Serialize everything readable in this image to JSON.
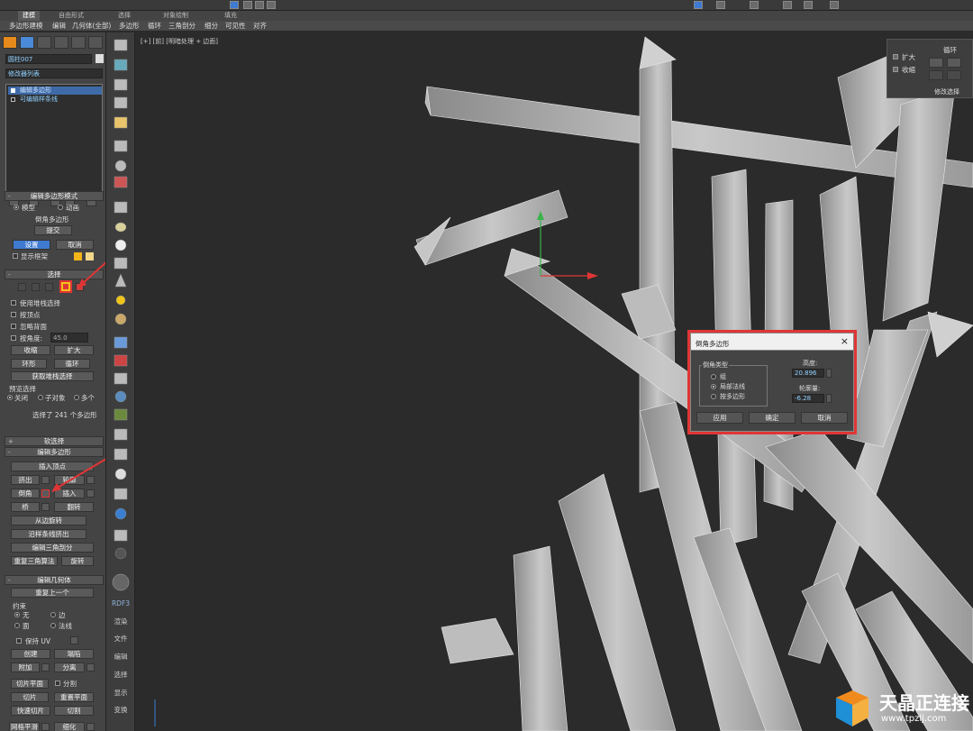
{
  "ribbon": {
    "tabs": [
      "建模",
      "自由形式",
      "选择",
      "对象绘制",
      "填充"
    ],
    "sub_items": [
      "多边形建模",
      "编辑",
      "几何体(全部)",
      "多边形",
      "循环",
      "三角剖分",
      "细分",
      "可见性",
      "对齐"
    ]
  },
  "command_panel": {
    "object_name": "圆柱007",
    "modifier_list": "修改器列表",
    "stack": [
      "编辑多边形",
      "可编辑样条线"
    ],
    "edit_poly_mode": {
      "title": "编辑多边形模式",
      "model": "模型",
      "animate": "动画",
      "sub_label": "倒角多边形",
      "commit": "提交",
      "settings": "设置",
      "cancel": "取消",
      "show_cage": "显示框架"
    },
    "selection": {
      "title": "选择",
      "use_stack": "使用堆栈选择",
      "by_vertex": "按顶点",
      "ignore_back": "忽略背面",
      "by_angle": "按角度:",
      "angle_value": "45.0",
      "shrink": "收缩",
      "grow": "扩大",
      "ring": "环形",
      "loop": "循环",
      "get_stack": "获取堆栈选择",
      "preview": "预览选择",
      "off": "关闭",
      "subobj": "子对象",
      "multi": "多个",
      "status": "选择了 241 个多边形"
    },
    "soft_selection": "软选择",
    "edit_polygons": {
      "title": "编辑多边形",
      "insert_vertex": "插入顶点",
      "extrude": "挤出",
      "outline": "轮廓",
      "bevel": "倒角",
      "inset": "插入",
      "bridge": "桥",
      "flip": "翻转",
      "hinge": "从边旋转",
      "extrude_spline": "沿样条线挤出",
      "edit_tri": "编辑三角剖分",
      "retri": "重复三角算法",
      "turn": "旋转"
    },
    "edit_geometry": {
      "title": "编辑几何体",
      "repeat": "重复上一个",
      "constraints": "约束",
      "none": "无",
      "edge": "边",
      "face": "面",
      "normal": "法线",
      "preserve_uv": "保持 UV",
      "create": "创建",
      "collapse": "塌陷",
      "attach": "附加",
      "detach": "分离",
      "slice_plane": "切片平面",
      "split": "分割",
      "slice": "切片",
      "reset_plane": "重置平面",
      "quickslice": "快速切片",
      "cut": "切割",
      "meshsmooth": "网格平滑",
      "tessellate": "细化"
    }
  },
  "side_toolbar": {
    "labels": [
      "RDF3",
      "渲染",
      "文件",
      "编辑",
      "选择",
      "显示",
      "变换"
    ]
  },
  "viewport": {
    "label": "[+] [前] [明暗处理 + 边面]"
  },
  "nav_panel": {
    "loop": "循环",
    "grow": "扩大",
    "shrink": "收缩",
    "modify_sel": "修改选择"
  },
  "bevel_dialog": {
    "title": "倒角多边形",
    "type_label": "倒角类型",
    "opt_group": "组",
    "opt_local": "局部法线",
    "opt_by_poly": "按多边形",
    "height_label": "高度:",
    "height_value": "20.896",
    "outline_label": "轮廓量:",
    "outline_value": "-6.28",
    "apply": "应用",
    "ok": "确定",
    "cancel": "取消"
  },
  "watermark": {
    "brand": "天晶正连接",
    "url": "www.tpzlj.com"
  },
  "colors": {
    "accent_blue": "#3f7ad1",
    "highlight_red": "#e03535",
    "dialog_border": "#e03535"
  }
}
